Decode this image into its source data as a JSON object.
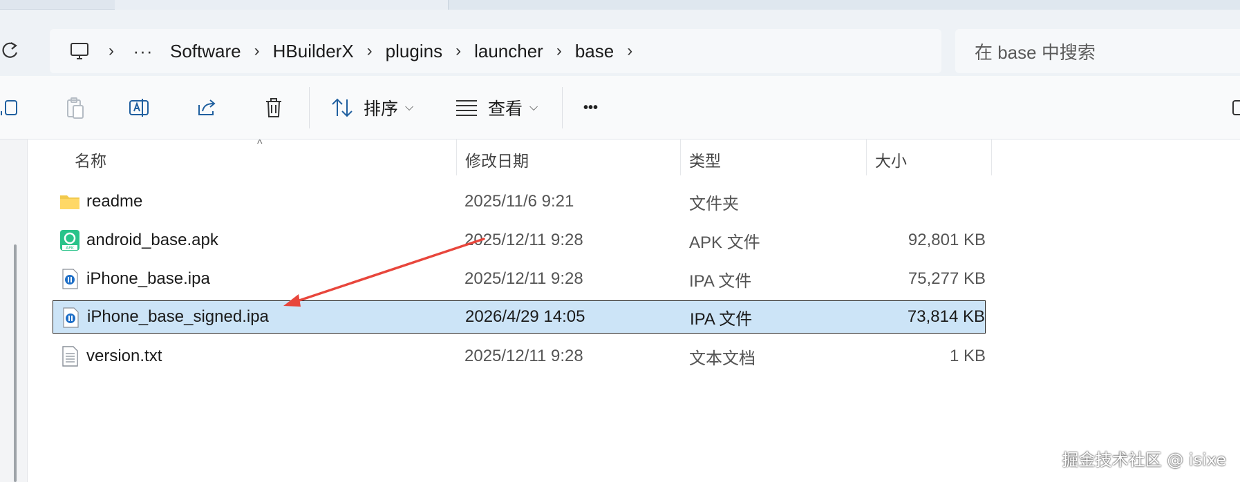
{
  "breadcrumb": {
    "items": [
      "Software",
      "HBuilderX",
      "plugins",
      "launcher",
      "base"
    ],
    "overflow": "···"
  },
  "search": {
    "placeholder": "在 base 中搜索"
  },
  "toolbar": {
    "sort_label": "排序",
    "view_label": "查看",
    "more_label": "•••"
  },
  "columns": {
    "name": "名称",
    "date": "修改日期",
    "type": "类型",
    "size": "大小"
  },
  "files": [
    {
      "name": "readme",
      "date": "2025/11/6 9:21",
      "type": "文件夹",
      "size": "",
      "icon": "folder-icon"
    },
    {
      "name": "android_base.apk",
      "date": "2025/12/11 9:28",
      "type": "APK 文件",
      "size": "92,801 KB",
      "icon": "apk-file-icon"
    },
    {
      "name": "iPhone_base.ipa",
      "date": "2025/12/11 9:28",
      "type": "IPA 文件",
      "size": "75,277 KB",
      "icon": "ipa-file-icon"
    },
    {
      "name": "iPhone_base_signed.ipa",
      "date": "2026/4/29 14:05",
      "type": "IPA 文件",
      "size": "73,814 KB",
      "icon": "ipa-file-icon",
      "selected": true
    },
    {
      "name": "version.txt",
      "date": "2025/12/11 9:28",
      "type": "文本文档",
      "size": "1 KB",
      "icon": "text-file-icon"
    }
  ],
  "annotation": {
    "arrow_color": "#e8463c"
  },
  "watermark": "掘金技术社区 @ isixe",
  "colors": {
    "selection": "#cce4f7",
    "accent": "#0067c0"
  }
}
